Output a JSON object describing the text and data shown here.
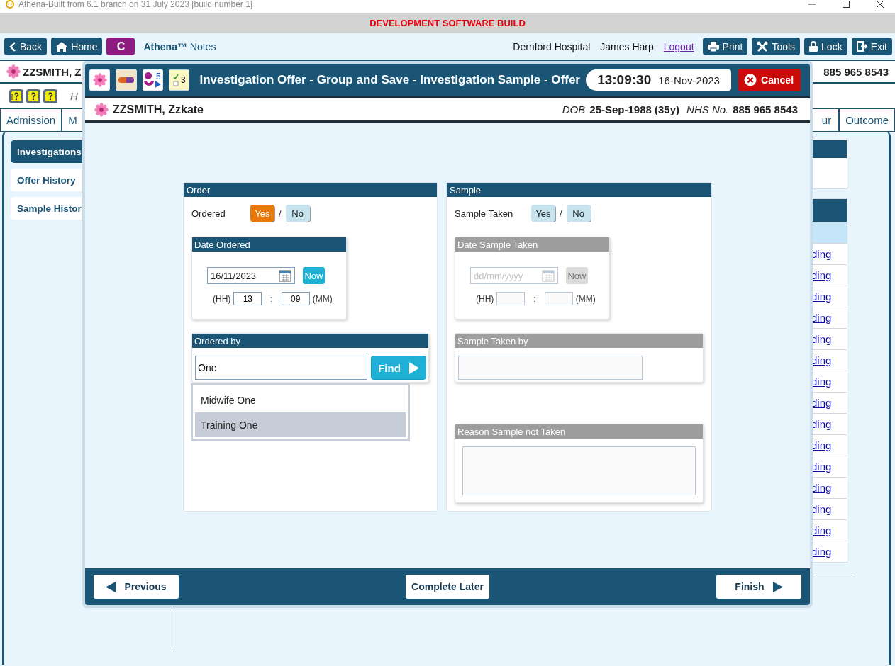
{
  "app_title": "Athena-Built from 6.1 branch on 31 July 2023 [build number 1]",
  "banner": "DEVELOPMENT SOFTWARE BUILD",
  "toolbar": {
    "nav_buttons": [
      {
        "kind": "back",
        "label": "Back"
      },
      {
        "kind": "home",
        "label": "Home"
      },
      {
        "kind": "letter",
        "label": "C"
      }
    ],
    "brand": "Athena™",
    "product": "Notes",
    "hospital": "Derriford Hospital",
    "user": "James Harp",
    "logout": "Logout",
    "actions": [
      {
        "kind": "print",
        "label": "Print"
      },
      {
        "kind": "tools",
        "label": "Tools"
      },
      {
        "kind": "lock",
        "label": "Lock"
      },
      {
        "kind": "exit",
        "label": "Exit"
      }
    ]
  },
  "patient_bar": {
    "name": "ZZSMITH, Z",
    "nhs_number": "885 965 8543"
  },
  "note_text": "H",
  "tabs": [
    {
      "label": "Admission",
      "selected": false
    },
    {
      "label": "M",
      "selected": false
    },
    {
      "label": "ur",
      "selected": false
    },
    {
      "label": "Outcome",
      "selected": false
    }
  ],
  "sidebar": [
    {
      "label": "Investigations",
      "selected": true
    },
    {
      "label": "Offer History",
      "selected": false
    },
    {
      "label": "Sample Histor",
      "selected": false
    }
  ],
  "results": {
    "rows": [
      {
        "column_1": "ding"
      },
      {
        "column_1": "ding"
      },
      {
        "column_1": "ding"
      },
      {
        "column_1": "ding"
      },
      {
        "column_1": "ding"
      },
      {
        "column_1": "ding"
      },
      {
        "column_1": "ding"
      },
      {
        "column_1": "ding"
      },
      {
        "column_1": "ding"
      },
      {
        "column_1": "ding"
      },
      {
        "column_1": "ding"
      },
      {
        "column_1": "ding"
      },
      {
        "column_1": "ding"
      },
      {
        "column_1": "ding"
      },
      {
        "column_1": "ding"
      }
    ]
  },
  "dialog": {
    "tiles": [
      {
        "kind": "flower"
      },
      {
        "kind": "capsule"
      },
      {
        "kind": "figure",
        "count": "5"
      },
      {
        "kind": "checklist",
        "count": "3"
      }
    ],
    "title": "Investigation Offer - Group and Save - Investigation Sample - Offer",
    "time": "13:09:30",
    "date": "16-Nov-2023",
    "cancel": "Cancel",
    "patient": {
      "name": "ZZSMITH, Zzkate",
      "dob_label": "DOB",
      "dob": "25-Sep-1988 (35y)",
      "nhs_label": "NHS No.",
      "nhs_number": "885 965 8543"
    },
    "order": {
      "title": "Order",
      "question": {
        "label": "Ordered",
        "divider": "/",
        "options": [
          {
            "label": "Yes",
            "selected": true
          },
          {
            "label": "No",
            "selected": false
          }
        ]
      },
      "date_panel": {
        "title": "Date Ordered",
        "disabled": false,
        "date": "16/11/2023",
        "now": "Now",
        "hh_label": "(HH)",
        "hours": "13",
        "separator": ":",
        "minutes": "09",
        "mm_label": "(MM)"
      },
      "by_panel": {
        "title": "Ordered by",
        "disabled": false,
        "value": "One",
        "find": "Find"
      },
      "suggestions": [
        {
          "label": "Midwife One",
          "selected": false
        },
        {
          "label": "Training One",
          "selected": true
        }
      ]
    },
    "sample": {
      "title": "Sample",
      "question": {
        "label": "Sample Taken",
        "divider": "/",
        "options": [
          {
            "label": "Yes",
            "selected": false
          },
          {
            "label": "No",
            "selected": false
          }
        ]
      },
      "date_panel": {
        "title": "Date Sample Taken",
        "disabled": true,
        "placeholder": "dd/mm/yyyy",
        "now": "Now",
        "hh_label": "(HH)",
        "separator": ":",
        "mm_label": "(MM)"
      },
      "by_panel": {
        "title": "Sample Taken by",
        "disabled": true
      },
      "reason_panel": {
        "title": "Reason Sample not Taken",
        "disabled": true
      }
    },
    "footer": {
      "previous": "Previous",
      "later": "Complete Later",
      "finish": "Finish"
    }
  }
}
